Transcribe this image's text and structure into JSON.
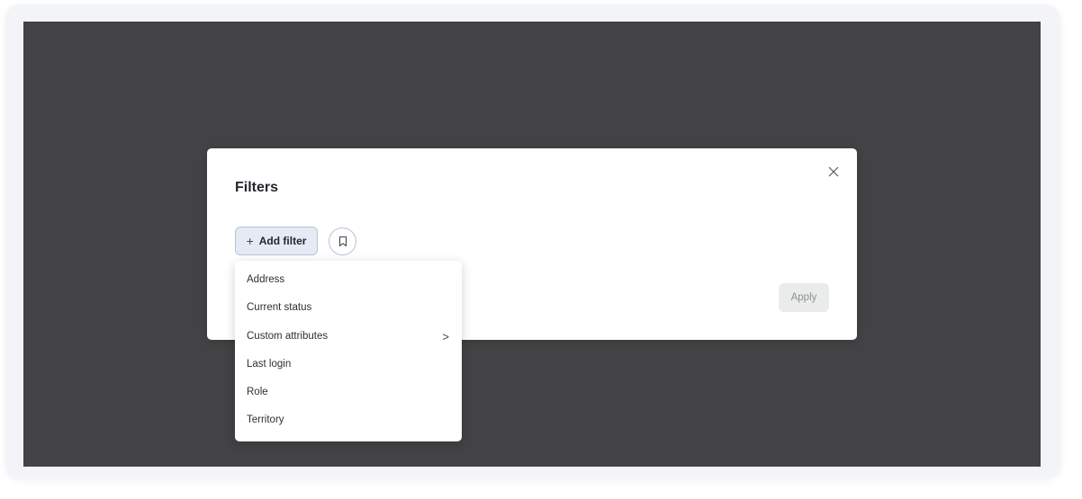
{
  "modal": {
    "title": "Filters",
    "add_filter_label": "Add filter",
    "apply_label": "Apply"
  },
  "icons": {
    "close": "close-icon",
    "plus": "plus-icon",
    "bookmark": "bookmark-icon",
    "chevron": "chevron-right-icon"
  },
  "dropdown": {
    "items": [
      {
        "label": "Address",
        "has_submenu": false
      },
      {
        "label": "Current status",
        "has_submenu": false
      },
      {
        "label": "Custom attributes",
        "has_submenu": true
      },
      {
        "label": "Last login",
        "has_submenu": false
      },
      {
        "label": "Role",
        "has_submenu": false
      },
      {
        "label": "Territory",
        "has_submenu": false
      }
    ]
  },
  "colors": {
    "overlay": "#434345",
    "accent_border": "#b7c3dc",
    "accent_fill": "#e6eaf4",
    "disabled_button": "#e9eceb"
  }
}
